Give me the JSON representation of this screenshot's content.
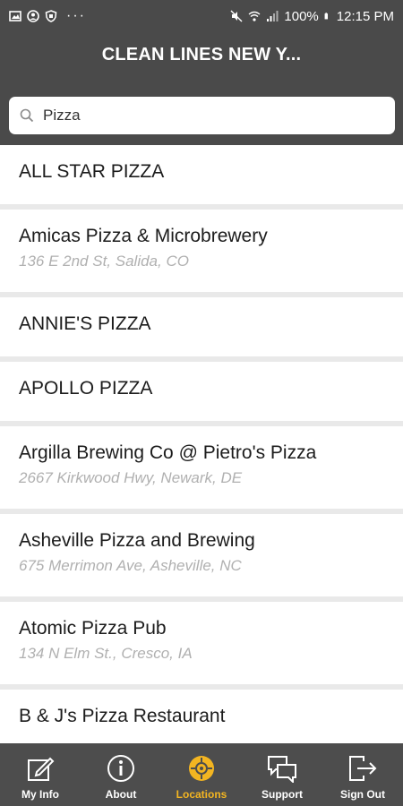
{
  "status_bar": {
    "battery": "100%",
    "time": "12:15 PM",
    "dots": "···"
  },
  "header": {
    "title": "CLEAN LINES NEW Y..."
  },
  "search": {
    "value": "Pizza",
    "icon": "search-icon"
  },
  "locations": [
    {
      "name": "ALL STAR PIZZA",
      "address": ""
    },
    {
      "name": "Amicas Pizza & Microbrewery",
      "address": "136 E 2nd St, Salida, CO"
    },
    {
      "name": "ANNIE'S PIZZA",
      "address": ""
    },
    {
      "name": "APOLLO PIZZA",
      "address": ""
    },
    {
      "name": "Argilla Brewing Co @ Pietro's Pizza",
      "address": "2667 Kirkwood Hwy, Newark, DE"
    },
    {
      "name": "Asheville Pizza and Brewing",
      "address": "675 Merrimon Ave, Asheville, NC"
    },
    {
      "name": "Atomic Pizza Pub",
      "address": "134 N Elm St., Cresco, IA"
    },
    {
      "name": "B & J's Pizza Restaurant",
      "address": ""
    }
  ],
  "tabs": [
    {
      "label": "My Info",
      "icon": "edit-icon"
    },
    {
      "label": "About",
      "icon": "info-icon"
    },
    {
      "label": "Locations",
      "icon": "location-target-icon"
    },
    {
      "label": "Support",
      "icon": "chat-icon"
    },
    {
      "label": "Sign Out",
      "icon": "sign-out-icon"
    }
  ],
  "colors": {
    "header_bg": "#4a4a4a",
    "accent": "#f3b521",
    "list_bg": "#e9e9e9",
    "address_text": "#b0b0b0"
  }
}
